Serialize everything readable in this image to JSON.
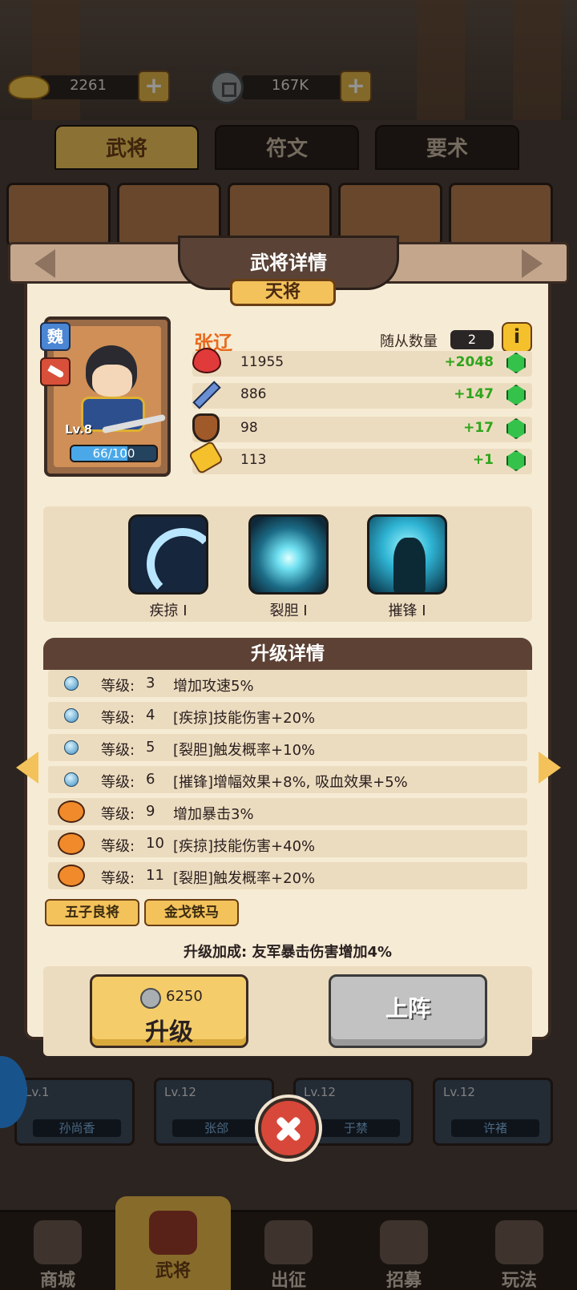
{
  "currency": {
    "gold": "2261",
    "coins": "167K"
  },
  "top_tabs": [
    "武将",
    "符文",
    "要术"
  ],
  "background_cards": [
    {
      "lv": "Lv.1",
      "name": "孙尚香"
    },
    {
      "lv": "Lv.12",
      "name": "张郃"
    },
    {
      "lv": "Lv.12",
      "name": "于禁"
    },
    {
      "lv": "Lv.12",
      "name": "许褚"
    }
  ],
  "modal": {
    "title": "武将详情",
    "rank": "天将",
    "hero": {
      "name": "张辽",
      "faction": "魏",
      "level": "Lv.8",
      "exp": "66/100",
      "exp_fraction": 0.66
    },
    "followers": {
      "label": "随从数量",
      "value": "2"
    },
    "stats": [
      {
        "icon": "heart-icon",
        "value": "11955",
        "bonus": "+2048"
      },
      {
        "icon": "sword-icon",
        "value": "886",
        "bonus": "+147"
      },
      {
        "icon": "shield-icon",
        "value": "98",
        "bonus": "+17"
      },
      {
        "icon": "boot-icon",
        "value": "113",
        "bonus": "+1"
      }
    ],
    "skills": [
      {
        "name": "疾掠 I"
      },
      {
        "name": "裂胆 I"
      },
      {
        "name": "摧锋 I"
      }
    ],
    "upgrade_title": "升级详情",
    "upgrade_rows": [
      {
        "icon": "orb",
        "label": "等级:",
        "level": "3",
        "effect": "增加攻速5%"
      },
      {
        "icon": "orb",
        "label": "等级:",
        "level": "4",
        "effect": "[疾掠]技能伤害+20%"
      },
      {
        "icon": "orb",
        "label": "等级:",
        "level": "5",
        "effect": "[裂胆]触发概率+10%"
      },
      {
        "icon": "orb",
        "label": "等级:",
        "level": "6",
        "effect": "[摧锋]增幅效果+8%, 吸血效果+5%"
      },
      {
        "icon": "pig",
        "label": "等级:",
        "level": "9",
        "effect": "增加暴击3%"
      },
      {
        "icon": "pig",
        "label": "等级:",
        "level": "10",
        "effect": "[疾掠]技能伤害+40%"
      },
      {
        "icon": "pig",
        "label": "等级:",
        "level": "11",
        "effect": "[裂胆]触发概率+20%"
      }
    ],
    "tags": [
      "五子良将",
      "金戈铁马"
    ],
    "bonus_text": "升级加成: 友军暴击伤害增加4%",
    "upgrade_button": {
      "cost": "6250",
      "label": "升级"
    },
    "deploy_button": {
      "label": "上阵"
    }
  },
  "bottom_nav": [
    "商城",
    "武将",
    "出征",
    "招募",
    "玩法"
  ]
}
